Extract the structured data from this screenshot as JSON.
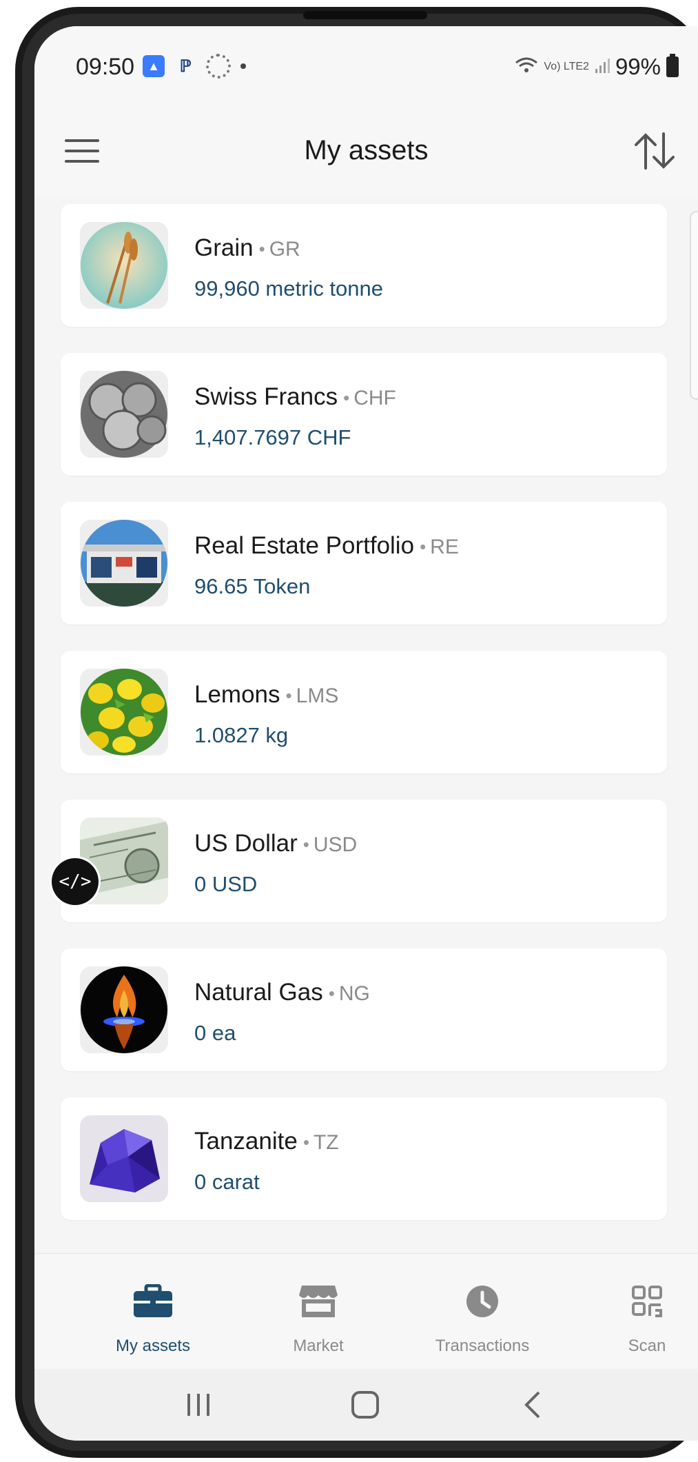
{
  "status_bar": {
    "time": "09:50",
    "network_label": "Vo) LTE2",
    "battery": "99%"
  },
  "header": {
    "title": "My assets"
  },
  "assets": [
    {
      "name": "Grain",
      "code": "GR",
      "balance": "99,960 metric tonne"
    },
    {
      "name": "Swiss Francs",
      "code": "CHF",
      "balance": "1,407.7697 CHF"
    },
    {
      "name": "Real Estate Portfolio",
      "code": "RE",
      "balance": "96.65 Token"
    },
    {
      "name": "Lemons",
      "code": "LMS",
      "balance": "1.0827 kg"
    },
    {
      "name": "US Dollar",
      "code": "USD",
      "balance": "0 USD"
    },
    {
      "name": "Natural Gas",
      "code": "NG",
      "balance": "0 ea"
    },
    {
      "name": "Tanzanite",
      "code": "TZ",
      "balance": "0 carat"
    }
  ],
  "code_badge": "</>",
  "bottom_nav": {
    "items": [
      {
        "label": "My assets",
        "icon": "briefcase-icon",
        "active": true
      },
      {
        "label": "Market",
        "icon": "store-icon",
        "active": false
      },
      {
        "label": "Transactions",
        "icon": "clock-icon",
        "active": false
      },
      {
        "label": "Scan",
        "icon": "qr-code-icon",
        "active": false
      }
    ]
  },
  "colors": {
    "accent": "#1f4e6e",
    "inactive": "#8a8a8a",
    "background": "#f5f5f5",
    "card": "#ffffff"
  }
}
